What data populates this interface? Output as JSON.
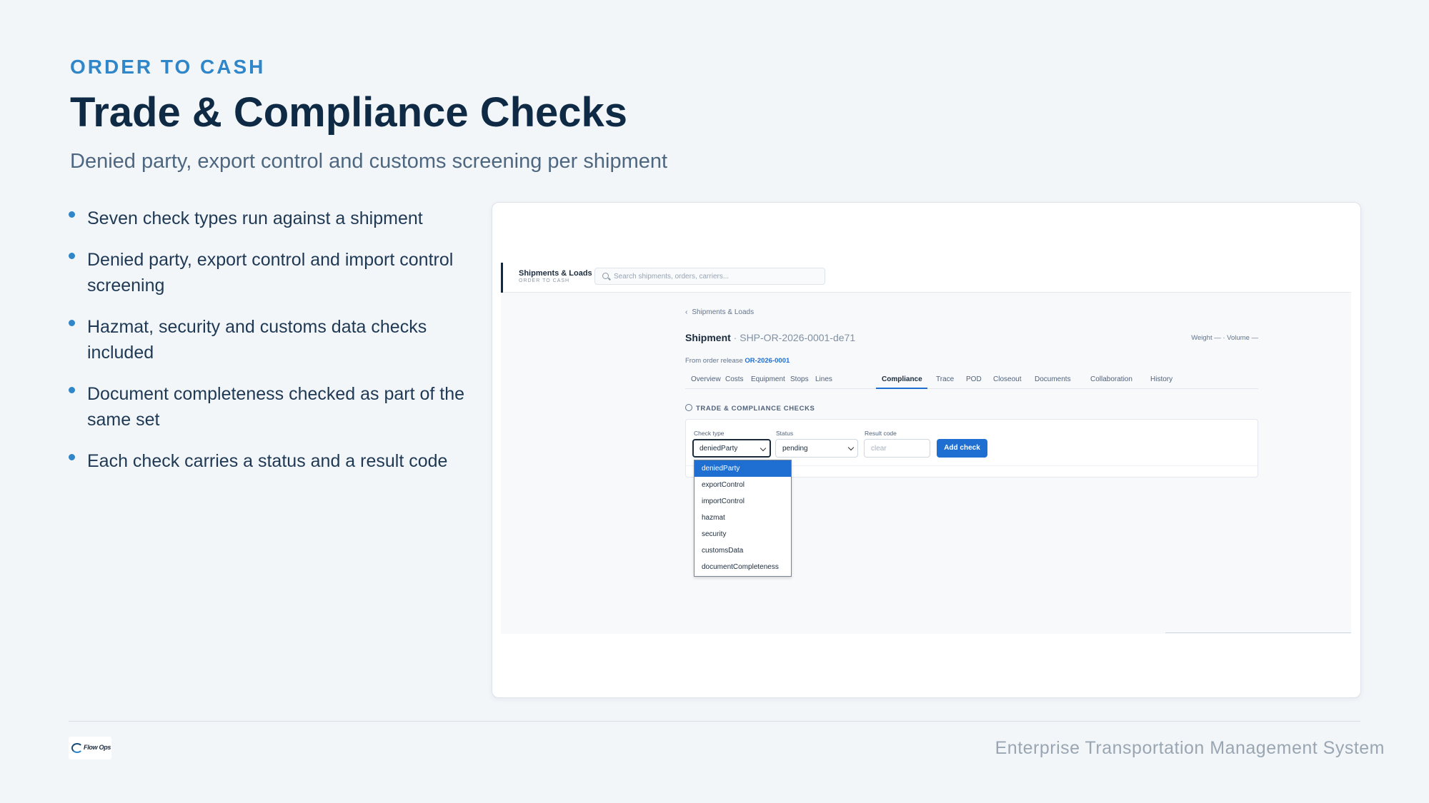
{
  "slide": {
    "eyebrow": "ORDER TO CASH",
    "title": "Trade & Compliance Checks",
    "subtitle": "Denied party, export control and customs screening per shipment",
    "bullets": [
      "Seven check types run against a shipment",
      "Denied party, export control and import control screening",
      "Hazmat, security and customs data checks included",
      "Document completeness checked as part of the same set",
      "Each check carries a status and a result code"
    ]
  },
  "app": {
    "brand": "Shipments & Loads",
    "brand_sub": "ORDER TO CASH",
    "search_placeholder": "Search shipments, orders, carriers...",
    "breadcrumb": "Shipments & Loads",
    "shipment_label": "Shipment",
    "shipment_sep": " · ",
    "shipment_id": "SHP-OR-2026-0001-de71",
    "weight_volume": "Weight — · Volume —",
    "release_prefix": "From order release ",
    "release_id": "OR-2026-0001",
    "tabs": [
      "Overview",
      "Costs",
      "Equipment",
      "Stops",
      "Lines",
      "Compliance",
      "Trace",
      "POD",
      "Closeout",
      "Documents",
      "Collaboration",
      "History"
    ],
    "active_tab": "Compliance",
    "section_title": "TRADE & COMPLIANCE CHECKS",
    "form": {
      "check_type_label": "Check type",
      "check_type_value": "deniedParty",
      "status_label": "Status",
      "status_value": "pending",
      "result_code_label": "Result code",
      "result_code_placeholder": "clear",
      "add_button": "Add check"
    },
    "check_type_options": [
      "deniedParty",
      "exportControl",
      "importControl",
      "hazmat",
      "security",
      "customsData",
      "documentCompleteness"
    ],
    "selected_option": "deniedParty"
  },
  "footer": {
    "logo_text": "Flow Ops",
    "system_name": "Enterprise Transportation Management System"
  },
  "colors": {
    "accent": "#2f86c9",
    "primary_button": "#1e6fd1",
    "title": "#0f2a44"
  }
}
